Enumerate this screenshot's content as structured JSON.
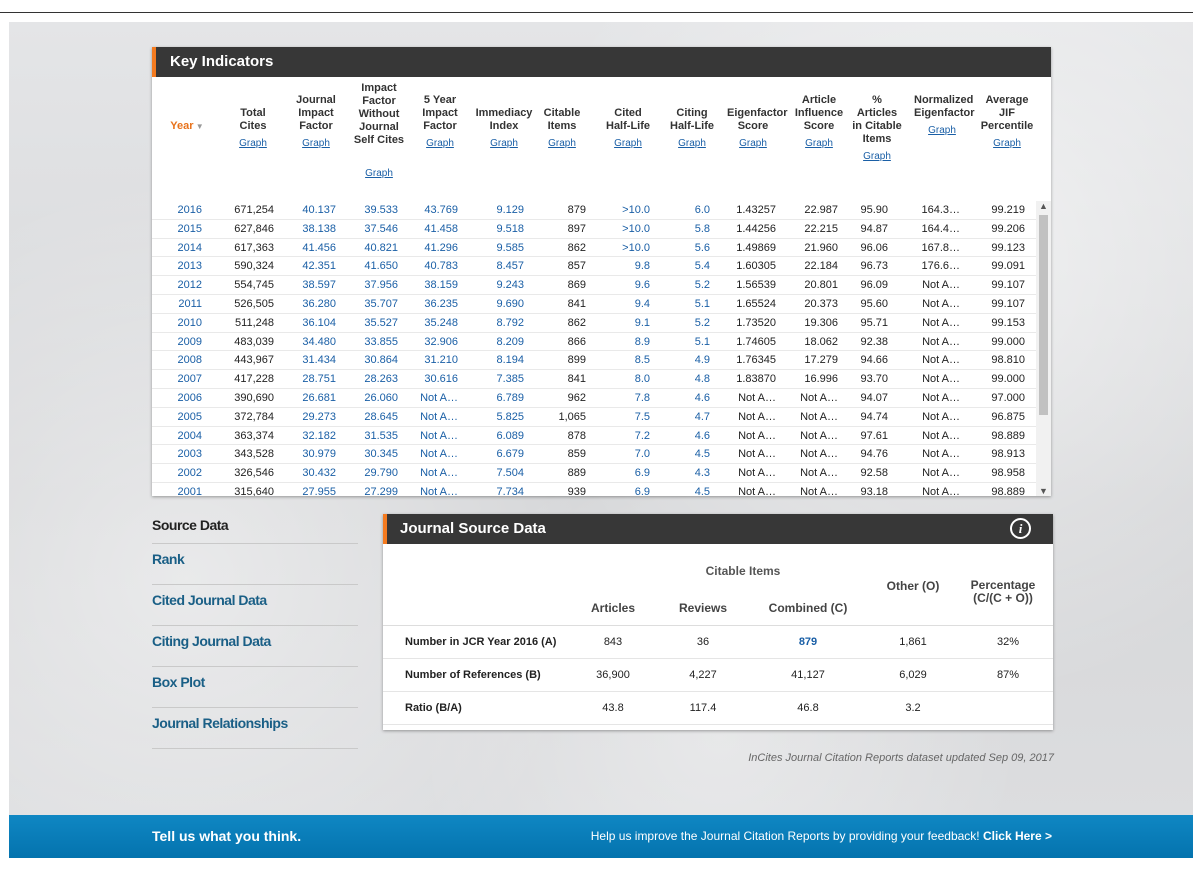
{
  "key_indicators": {
    "title": "Key Indicators",
    "columns": [
      {
        "label": "Year",
        "graph": ""
      },
      {
        "label": "Total Cites",
        "graph": "Graph"
      },
      {
        "label": "Journal Impact Factor",
        "graph": "Graph"
      },
      {
        "label": "Impact Factor Without Journal Self Cites",
        "graph": "Graph"
      },
      {
        "label": "5 Year Impact Factor",
        "graph": "Graph"
      },
      {
        "label": "Immediacy Index",
        "graph": "Graph"
      },
      {
        "label": "Citable Items",
        "graph": "Graph"
      },
      {
        "label": "Cited Half-Life",
        "graph": "Graph"
      },
      {
        "label": "Citing Half-Life",
        "graph": "Graph"
      },
      {
        "label": "Eigenfactor Score",
        "graph": "Graph"
      },
      {
        "label": "Article Influence Score",
        "graph": "Graph"
      },
      {
        "label": "% Articles in Citable Items",
        "graph": "Graph"
      },
      {
        "label": "Normalized Eigenfactor",
        "graph": "Graph"
      },
      {
        "label": "Average JIF Percentile",
        "graph": "Graph"
      }
    ],
    "year_sort_icon": "sort-down-icon",
    "rows": [
      [
        "2016",
        "671,254",
        "40.137",
        "39.533",
        "43.769",
        "9.129",
        "879",
        ">10.0",
        "6.0",
        "1.43257",
        "22.987",
        "95.90",
        "164.3…",
        "99.219"
      ],
      [
        "2015",
        "627,846",
        "38.138",
        "37.546",
        "41.458",
        "9.518",
        "897",
        ">10.0",
        "5.8",
        "1.44256",
        "22.215",
        "94.87",
        "164.4…",
        "99.206"
      ],
      [
        "2014",
        "617,363",
        "41.456",
        "40.821",
        "41.296",
        "9.585",
        "862",
        ">10.0",
        "5.6",
        "1.49869",
        "21.960",
        "96.06",
        "167.8…",
        "99.123"
      ],
      [
        "2013",
        "590,324",
        "42.351",
        "41.650",
        "40.783",
        "8.457",
        "857",
        "9.8",
        "5.4",
        "1.60305",
        "22.184",
        "96.73",
        "176.6…",
        "99.091"
      ],
      [
        "2012",
        "554,745",
        "38.597",
        "37.956",
        "38.159",
        "9.243",
        "869",
        "9.6",
        "5.2",
        "1.56539",
        "20.801",
        "96.09",
        "Not A…",
        "99.107"
      ],
      [
        "2011",
        "526,505",
        "36.280",
        "35.707",
        "36.235",
        "9.690",
        "841",
        "9.4",
        "5.1",
        "1.65524",
        "20.373",
        "95.60",
        "Not A…",
        "99.107"
      ],
      [
        "2010",
        "511,248",
        "36.104",
        "35.527",
        "35.248",
        "8.792",
        "862",
        "9.1",
        "5.2",
        "1.73520",
        "19.306",
        "95.71",
        "Not A…",
        "99.153"
      ],
      [
        "2009",
        "483,039",
        "34.480",
        "33.855",
        "32.906",
        "8.209",
        "866",
        "8.9",
        "5.1",
        "1.74605",
        "18.062",
        "92.38",
        "Not A…",
        "99.000"
      ],
      [
        "2008",
        "443,967",
        "31.434",
        "30.864",
        "31.210",
        "8.194",
        "899",
        "8.5",
        "4.9",
        "1.76345",
        "17.279",
        "94.66",
        "Not A…",
        "98.810"
      ],
      [
        "2007",
        "417,228",
        "28.751",
        "28.263",
        "30.616",
        "7.385",
        "841",
        "8.0",
        "4.8",
        "1.83870",
        "16.996",
        "93.70",
        "Not A…",
        "99.000"
      ],
      [
        "2006",
        "390,690",
        "26.681",
        "26.060",
        "Not A…",
        "6.789",
        "962",
        "7.8",
        "4.6",
        "Not A…",
        "Not A…",
        "94.07",
        "Not A…",
        "97.000"
      ],
      [
        "2005",
        "372,784",
        "29.273",
        "28.645",
        "Not A…",
        "5.825",
        "1,065",
        "7.5",
        "4.7",
        "Not A…",
        "Not A…",
        "94.74",
        "Not A…",
        "96.875"
      ],
      [
        "2004",
        "363,374",
        "32.182",
        "31.535",
        "Not A…",
        "6.089",
        "878",
        "7.2",
        "4.6",
        "Not A…",
        "Not A…",
        "97.61",
        "Not A…",
        "98.889"
      ],
      [
        "2003",
        "343,528",
        "30.979",
        "30.345",
        "Not A…",
        "6.679",
        "859",
        "7.0",
        "4.5",
        "Not A…",
        "Not A…",
        "94.76",
        "Not A…",
        "98.913"
      ],
      [
        "2002",
        "326,546",
        "30.432",
        "29.790",
        "Not A…",
        "7.504",
        "889",
        "6.9",
        "4.3",
        "Not A…",
        "Not A…",
        "92.58",
        "Not A…",
        "98.958"
      ],
      [
        "2001",
        "315,640",
        "27.955",
        "27.299",
        "Not A…",
        "7.734",
        "939",
        "6.9",
        "4.5",
        "Not A…",
        "Not A…",
        "93.18",
        "Not A…",
        "98.889"
      ]
    ]
  },
  "nav": {
    "items": [
      "Source Data",
      "Rank",
      "Cited Journal Data",
      "Citing Journal Data",
      "Box Plot",
      "Journal Relationships"
    ]
  },
  "journal_source_data": {
    "title": "Journal Source Data",
    "info_icon": "info-icon",
    "group_header": "Citable Items",
    "headers": {
      "articles": "Articles",
      "reviews": "Reviews",
      "combined": "Combined  (C)",
      "other": "Other (O)",
      "percentage": "Percentage (C/(C + O))"
    },
    "rows": [
      {
        "label": "Number in JCR Year 2016 (A)",
        "articles": "843",
        "reviews": "36",
        "combined": "879",
        "other": "1,861",
        "percentage": "32%"
      },
      {
        "label": "Number of References (B)",
        "articles": "36,900",
        "reviews": "4,227",
        "combined": "41,127",
        "other": "6,029",
        "percentage": "87%"
      },
      {
        "label": "Ratio (B/A)",
        "articles": "43.8",
        "reviews": "117.4",
        "combined": "46.8",
        "other": "3.2",
        "percentage": ""
      }
    ],
    "footnote": "InCites Journal Citation Reports dataset updated Sep 09, 2017"
  },
  "footer": {
    "left": "Tell us what you think.",
    "right_text": "Help us improve the Journal Citation Reports by providing your feedback! ",
    "right_link": "Click Here >"
  },
  "colors": {
    "accent": "#f47b20",
    "header_bg": "#373737",
    "link": "#1a5fa6",
    "footer": "#0a7dba"
  }
}
